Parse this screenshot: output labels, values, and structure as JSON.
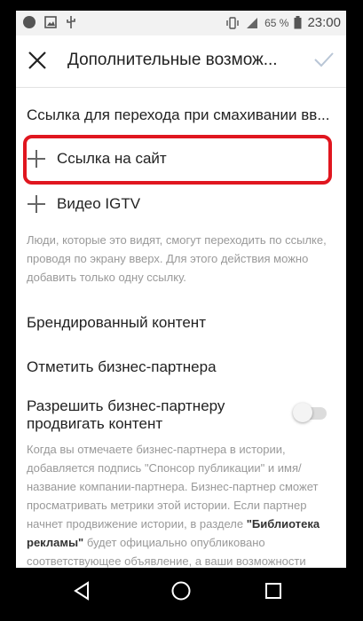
{
  "status": {
    "battery": "65 %",
    "time": "23:00"
  },
  "header": {
    "title": "Дополнительные возмож..."
  },
  "swipe_section": {
    "title": "Ссылка для перехода при смахивании вв..."
  },
  "options": [
    {
      "label": "Ссылка на сайт"
    },
    {
      "label": "Видео IGTV"
    }
  ],
  "swipe_hint": "Люди, которые это видят, смогут переходить по ссылке, проводя по экрану вверх. Для этого действия можно добавить только одну ссылку.",
  "branded": {
    "title": "Брендированный контент",
    "tag_partner": "Отметить бизнес-партнера",
    "allow_promo": "Разрешить бизнес-партнеру продвигать контент",
    "allow_promo_enabled": false,
    "desc_part1": "Когда вы отмечаете бизнес-партнера в истории, добавляется подпись \"Спонсор публикации\" и имя/название компании-партнера. Бизнес-партнер сможет просматривать метрики этой истории. Если партнер начнет продвижение истории, в разделе ",
    "desc_link": "\"Библиотека рекламы\"",
    "desc_part2": " будет официально опубликовано соответствующее объявление, а ваши возможности"
  },
  "icons": {
    "close": "close-icon",
    "confirm": "checkmark-icon",
    "back": "back-triangle-icon",
    "home": "home-circle-icon",
    "recents": "recents-square-icon"
  },
  "colors": {
    "highlight": "#e0161f"
  }
}
